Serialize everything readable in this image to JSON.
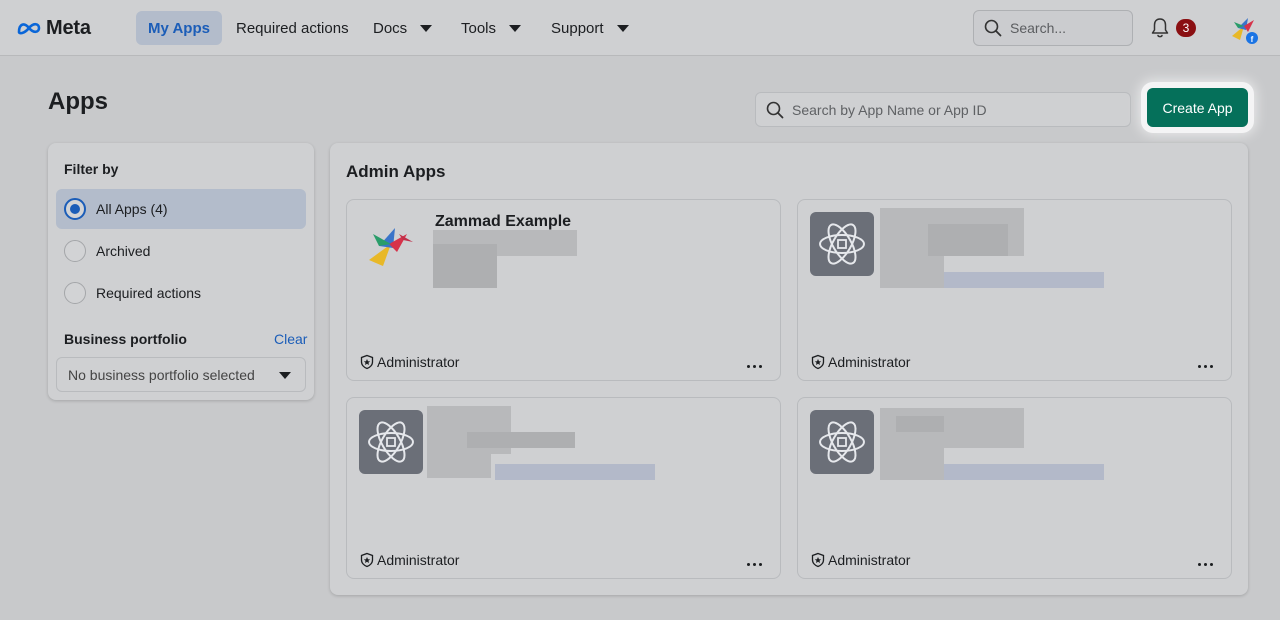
{
  "nav": {
    "brand": "Meta",
    "items": [
      {
        "label": "My Apps",
        "active": true
      },
      {
        "label": "Required actions"
      },
      {
        "label": "Docs",
        "dropdown": true
      },
      {
        "label": "Tools",
        "dropdown": true
      },
      {
        "label": "Support",
        "dropdown": true
      }
    ],
    "search_placeholder": "Search...",
    "notification_count": "3"
  },
  "page": {
    "title": "Apps",
    "search_placeholder": "Search by App Name or App ID",
    "create_label": "Create App"
  },
  "filter": {
    "title": "Filter by",
    "options": [
      {
        "label": "All Apps (4)",
        "selected": true
      },
      {
        "label": "Archived",
        "selected": false
      },
      {
        "label": "Required actions",
        "selected": false
      }
    ],
    "portfolio_label": "Business portfolio",
    "clear_label": "Clear",
    "portfolio_value": "No business portfolio selected"
  },
  "apps": {
    "section_title": "Admin Apps",
    "cards": [
      {
        "name": "Zammad Example",
        "role": "Administrator",
        "icon": "zammad-logo-icon"
      },
      {
        "name": "",
        "role": "Administrator",
        "icon": "atom-app-icon"
      },
      {
        "name": "",
        "role": "Administrator",
        "icon": "atom-app-icon"
      },
      {
        "name": "",
        "role": "Administrator",
        "icon": "atom-app-icon"
      }
    ]
  },
  "colors": {
    "accent": "#1b5db8",
    "create_button": "#05705a",
    "badge": "#8a0f12"
  }
}
